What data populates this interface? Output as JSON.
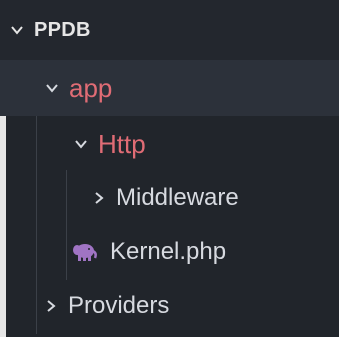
{
  "explorer": {
    "root_label": "PPDB",
    "items": [
      {
        "label": "app",
        "state": "expanded"
      },
      {
        "label": "Http",
        "state": "expanded"
      },
      {
        "label": "Middleware",
        "state": "collapsed"
      },
      {
        "label": "Kernel.php",
        "icon": "php-elephant-icon"
      },
      {
        "label": "Providers",
        "state": "collapsed"
      }
    ]
  },
  "colors": {
    "background": "#21252b",
    "selected_row": "#2c313a",
    "accent_folder": "#e06c75",
    "text": "#d7dae0",
    "php_icon": "#a074c4"
  }
}
